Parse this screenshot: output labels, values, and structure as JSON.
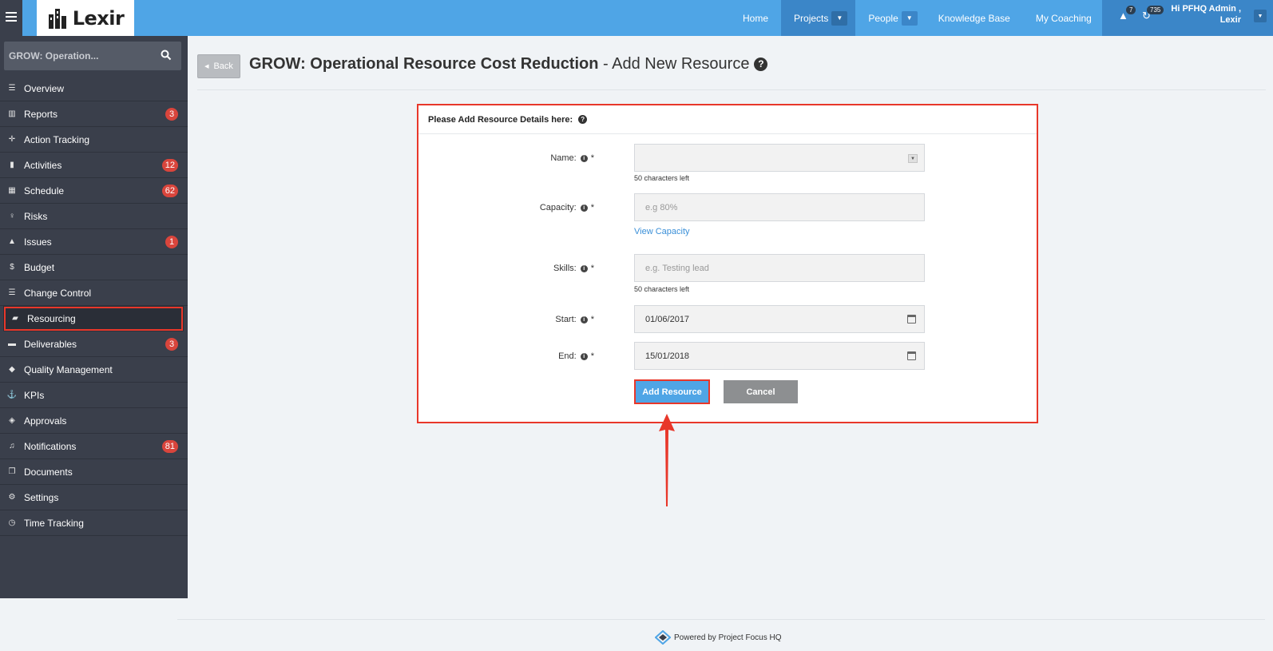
{
  "topbar": {
    "logo_text": "Lexir",
    "nav": [
      {
        "label": "Home",
        "caret": false,
        "active": false
      },
      {
        "label": "Projects",
        "caret": true,
        "active": true
      },
      {
        "label": "People",
        "caret": true,
        "active": false
      },
      {
        "label": "Knowledge Base",
        "caret": false,
        "active": false
      },
      {
        "label": "My Coaching",
        "caret": false,
        "active": false
      }
    ],
    "alerts_count": "7",
    "messages_count": "735",
    "user_greeting_line1": "Hi PFHQ Admin ,",
    "user_greeting_line2": "Lexir"
  },
  "sidebar": {
    "search_text": "GROW: Operation...",
    "items": [
      {
        "label": "Overview",
        "icon": "list-icon",
        "glyph": "☰",
        "badge": ""
      },
      {
        "label": "Reports",
        "icon": "bar-chart-icon",
        "glyph": "▥",
        "badge": "3"
      },
      {
        "label": "Action Tracking",
        "icon": "crosshair-icon",
        "glyph": "✛",
        "badge": ""
      },
      {
        "label": "Activities",
        "icon": "bookmark-icon",
        "glyph": "▮",
        "badge": "12"
      },
      {
        "label": "Schedule",
        "icon": "calendar-icon",
        "glyph": "▦",
        "badge": "62"
      },
      {
        "label": "Risks",
        "icon": "lightbulb-icon",
        "glyph": "♀",
        "badge": ""
      },
      {
        "label": "Issues",
        "icon": "warning-icon",
        "glyph": "▲",
        "badge": "1"
      },
      {
        "label": "Budget",
        "icon": "dollar-icon",
        "glyph": "$",
        "badge": ""
      },
      {
        "label": "Change Control",
        "icon": "list-icon",
        "glyph": "☰",
        "badge": ""
      },
      {
        "label": "Resourcing",
        "icon": "folder-open-icon",
        "glyph": "▰",
        "badge": ""
      },
      {
        "label": "Deliverables",
        "icon": "truck-icon",
        "glyph": "▬",
        "badge": "3"
      },
      {
        "label": "Quality Management",
        "icon": "tag-icon",
        "glyph": "◆",
        "badge": ""
      },
      {
        "label": "KPIs",
        "icon": "anchor-icon",
        "glyph": "⚓",
        "badge": ""
      },
      {
        "label": "Approvals",
        "icon": "tags-icon",
        "glyph": "◈",
        "badge": ""
      },
      {
        "label": "Notifications",
        "icon": "bell-icon",
        "glyph": "♫",
        "badge": "81"
      },
      {
        "label": "Documents",
        "icon": "copy-icon",
        "glyph": "❐",
        "badge": ""
      },
      {
        "label": "Settings",
        "icon": "cogs-icon",
        "glyph": "⚙",
        "badge": ""
      },
      {
        "label": "Time Tracking",
        "icon": "clock-icon",
        "glyph": "◷",
        "badge": ""
      }
    ]
  },
  "page": {
    "back_label": "Back",
    "title_bold": "GROW: Operational Resource Cost Reduction",
    "title_rest": " - Add New Resource"
  },
  "form": {
    "heading": "Please Add Resource Details here:",
    "name_label": "Name:",
    "name_value": "",
    "name_hint": "50 characters left",
    "capacity_label": "Capacity:",
    "capacity_placeholder": "e.g 80%",
    "view_capacity": "View Capacity",
    "skills_label": "Skills:",
    "skills_placeholder": "e.g. Testing lead",
    "skills_hint": "50 characters left",
    "start_label": "Start:",
    "start_value": "01/06/2017",
    "end_label": "End:",
    "end_value": "15/01/2018",
    "required_mark": "*",
    "add_button": "Add Resource",
    "cancel_button": "Cancel"
  },
  "footer": {
    "text": "Powered by Project Focus HQ"
  },
  "colors": {
    "topbar": "#4fa5e6",
    "sidebar": "#3a3f4b",
    "highlight": "#e8372a",
    "badge": "#d9453c"
  }
}
